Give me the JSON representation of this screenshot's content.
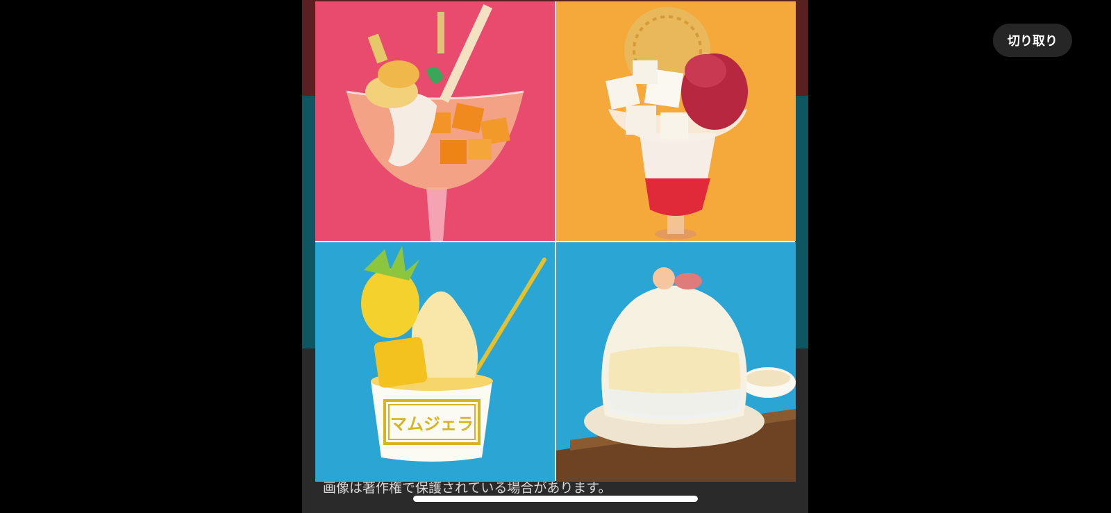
{
  "toolbar": {
    "crop_label": "切り取り"
  },
  "background_page": {
    "caption": "画像は著作権で保護されている場合があります。"
  },
  "image": {
    "panels": [
      {
        "content": "mango-parfait",
        "bg_color": "#e84b6e"
      },
      {
        "content": "strawberry-parfait",
        "bg_color": "#f6a93b"
      },
      {
        "content": "pineapple-gelato",
        "bg_color": "#2aa5d4"
      },
      {
        "content": "shaved-ice",
        "bg_color": "#2aa5d4"
      }
    ],
    "cup_logo_text": "マムジェラ"
  }
}
